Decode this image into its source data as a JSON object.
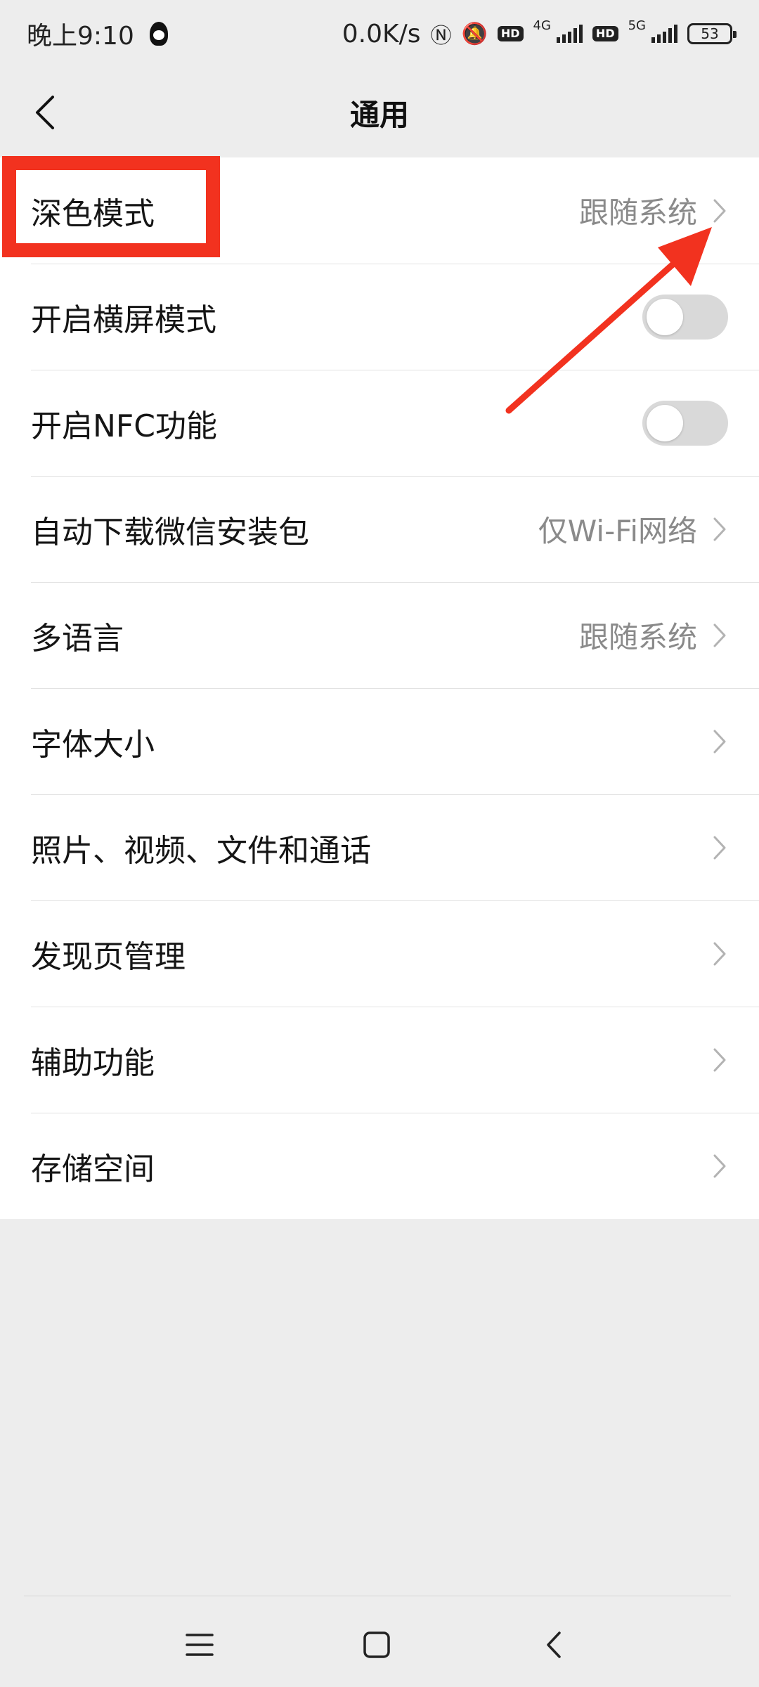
{
  "status_bar": {
    "time": "晚上9:10",
    "net_speed": "0.0K/s",
    "nfc_icon_glyph": "Ⓝ",
    "mute_icon_glyph": "🔕",
    "hd_label": "HD",
    "sim1_network": "4G",
    "sim2_network": "5G",
    "battery_level": "53"
  },
  "header": {
    "title": "通用"
  },
  "settings": {
    "dark_mode": {
      "label": "深色模式",
      "value": "跟随系统"
    },
    "landscape": {
      "label": "开启横屏模式",
      "enabled": false
    },
    "nfc": {
      "label": "开启NFC功能",
      "enabled": false
    },
    "auto_download": {
      "label": "自动下载微信安装包",
      "value": "仅Wi-Fi网络"
    },
    "language": {
      "label": "多语言",
      "value": "跟随系统"
    },
    "font_size": {
      "label": "字体大小"
    },
    "media": {
      "label": "照片、视频、文件和通话"
    },
    "discover": {
      "label": "发现页管理"
    },
    "accessibility": {
      "label": "辅助功能"
    },
    "storage": {
      "label": "存储空间"
    }
  },
  "annotation_color": "#f2321f",
  "nav_icons": [
    "menu-icon",
    "home-icon",
    "back-icon"
  ]
}
